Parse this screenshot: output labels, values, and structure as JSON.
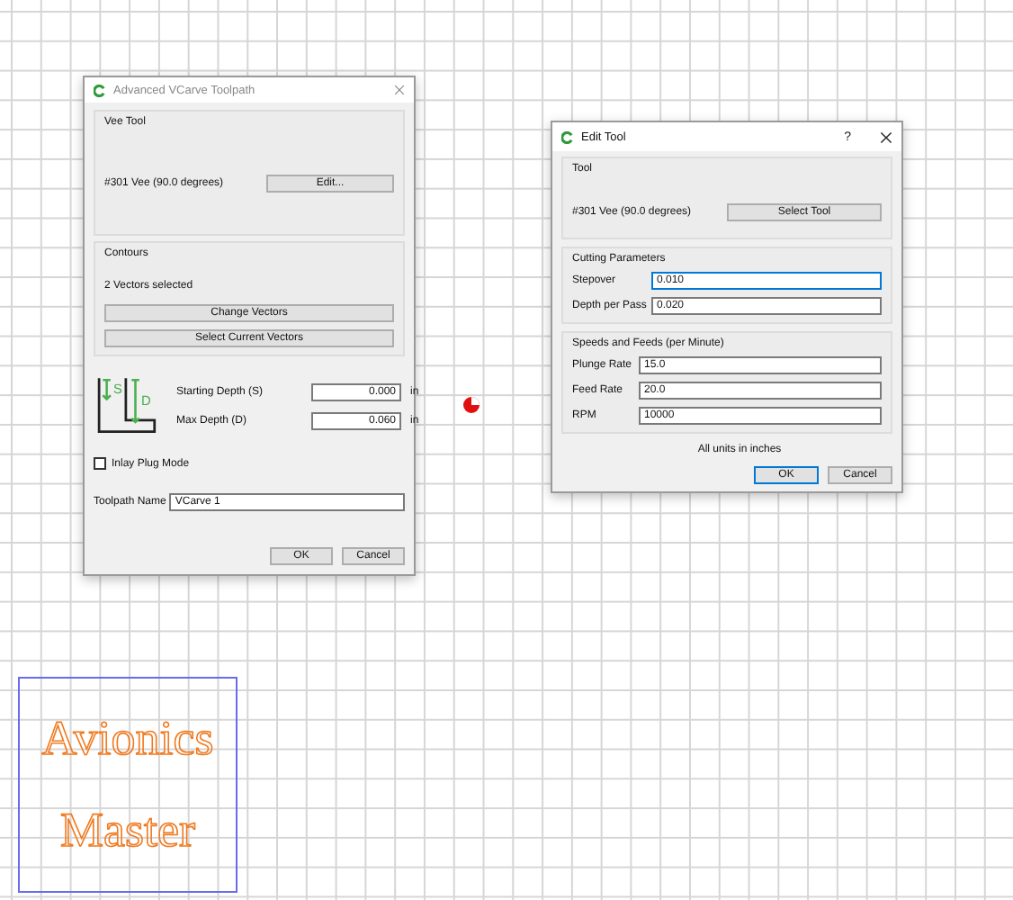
{
  "canvas": {
    "texts": [
      "Avionics",
      "Master"
    ]
  },
  "vcarve_dialog": {
    "title": "Advanced VCarve Toolpath",
    "vee_tool": {
      "heading": "Vee Tool",
      "tool": "#301 Vee (90.0 degrees)",
      "button": "Edit..."
    },
    "contours": {
      "heading": "Contours",
      "status": "2 Vectors selected",
      "buttons": [
        "Change Vectors",
        "Select Current Vectors"
      ]
    },
    "depths": [
      {
        "label": "Starting Depth (S)",
        "value": "0.000",
        "unit": "in"
      },
      {
        "label": "Max Depth (D)",
        "value": "0.060",
        "unit": "in"
      }
    ],
    "diagram_labels": [
      "S",
      "D"
    ],
    "inlay": {
      "label": "Inlay Plug Mode",
      "checked": false
    },
    "toolpath_name": {
      "label": "Toolpath Name",
      "value": "VCarve 1"
    },
    "buttons": [
      "OK",
      "Cancel"
    ]
  },
  "edit_tool_dialog": {
    "title": "Edit Tool",
    "help": "?",
    "tool": {
      "heading": "Tool",
      "tool": "#301 Vee (90.0 degrees)",
      "button": "Select Tool"
    },
    "groups": [
      {
        "heading": "Cutting Parameters",
        "fields": [
          {
            "label": "Stepover",
            "value": "0.010",
            "focused": true
          },
          {
            "label": "Depth per Pass",
            "value": "0.020",
            "focused": false
          }
        ]
      },
      {
        "heading": "Speeds and Feeds (per Minute)",
        "fields": [
          {
            "label": "Plunge Rate",
            "value": "15.0",
            "focused": false
          },
          {
            "label": "Feed Rate",
            "value": "20.0",
            "focused": false
          },
          {
            "label": "RPM",
            "value": "10000",
            "focused": false
          }
        ]
      }
    ],
    "note": "All units in inches",
    "buttons": [
      {
        "label": "OK",
        "default": true
      },
      {
        "label": "Cancel",
        "default": false
      }
    ]
  }
}
